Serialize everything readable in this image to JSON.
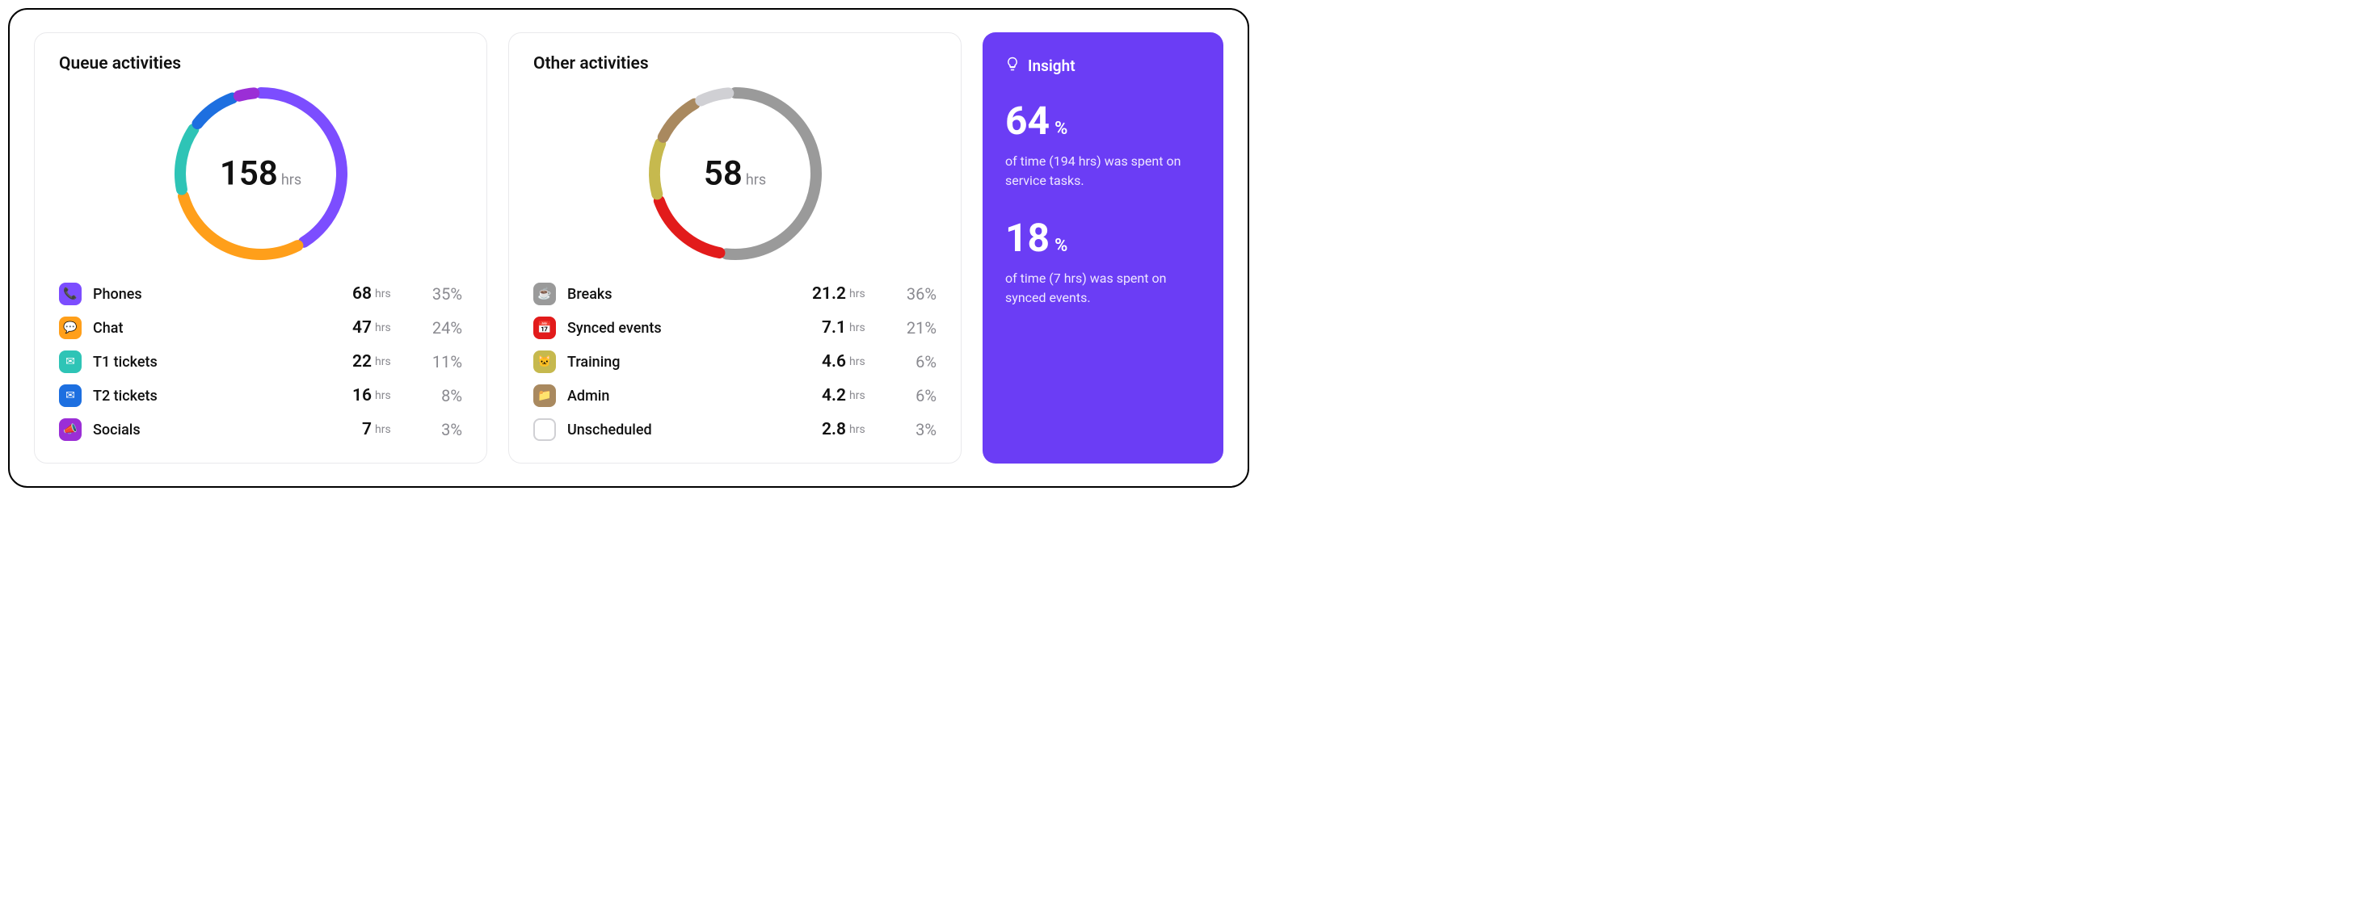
{
  "queue": {
    "title": "Queue activities",
    "total_value": "158",
    "total_unit": "hrs",
    "items": [
      {
        "label": "Phones",
        "hours": "68",
        "unit": "hrs",
        "pct": "35%",
        "icon": "phones",
        "color": "#7c4dff"
      },
      {
        "label": "Chat",
        "hours": "47",
        "unit": "hrs",
        "pct": "24%",
        "icon": "chat",
        "color": "#ff9f1a"
      },
      {
        "label": "T1 tickets",
        "hours": "22",
        "unit": "hrs",
        "pct": "11%",
        "icon": "t1",
        "color": "#2ec4b6"
      },
      {
        "label": "T2 tickets",
        "hours": "16",
        "unit": "hrs",
        "pct": "8%",
        "icon": "t2",
        "color": "#1d6fe0"
      },
      {
        "label": "Socials",
        "hours": "7",
        "unit": "hrs",
        "pct": "3%",
        "icon": "socials",
        "color": "#9b2ed6"
      }
    ]
  },
  "other": {
    "title": "Other activities",
    "total_value": "58",
    "total_unit": "hrs",
    "items": [
      {
        "label": "Breaks",
        "hours": "21.2",
        "unit": "hrs",
        "pct": "36%",
        "icon": "breaks",
        "color": "#9a9a9a"
      },
      {
        "label": "Synced events",
        "hours": "7.1",
        "unit": "hrs",
        "pct": "21%",
        "icon": "synced",
        "color": "#e21b1b"
      },
      {
        "label": "Training",
        "hours": "4.6",
        "unit": "hrs",
        "pct": "6%",
        "icon": "training",
        "color": "#c6b94e"
      },
      {
        "label": "Admin",
        "hours": "4.2",
        "unit": "hrs",
        "pct": "6%",
        "icon": "admin",
        "color": "#a9895f"
      },
      {
        "label": "Unscheduled",
        "hours": "2.8",
        "unit": "hrs",
        "pct": "3%",
        "icon": "unsched",
        "color": "#ffffff"
      }
    ]
  },
  "insight": {
    "heading": "Insight",
    "stat1_value": "64",
    "stat1_pct": "%",
    "stat1_text": "of time (194 hrs) was spent on service tasks.",
    "stat2_value": "18",
    "stat2_pct": "%",
    "stat2_text": "of time (7 hrs) was spent on synced events."
  },
  "chart_data": [
    {
      "type": "pie",
      "title": "Queue activities",
      "center_label": "158 hrs",
      "series": [
        {
          "name": "Phones",
          "value": 68,
          "pct": 35,
          "color": "#7c4dff"
        },
        {
          "name": "Chat",
          "value": 47,
          "pct": 24,
          "color": "#ff9f1a"
        },
        {
          "name": "T1 tickets",
          "value": 22,
          "pct": 11,
          "color": "#2ec4b6"
        },
        {
          "name": "T2 tickets",
          "value": 16,
          "pct": 8,
          "color": "#1d6fe0"
        },
        {
          "name": "Socials",
          "value": 7,
          "pct": 3,
          "color": "#9b2ed6"
        }
      ]
    },
    {
      "type": "pie",
      "title": "Other activities",
      "center_label": "58 hrs",
      "series": [
        {
          "name": "Breaks",
          "value": 21.2,
          "pct": 36,
          "color": "#9a9a9a"
        },
        {
          "name": "Synced events",
          "value": 7.1,
          "pct": 21,
          "color": "#e21b1b"
        },
        {
          "name": "Training",
          "value": 4.6,
          "pct": 6,
          "color": "#c6b94e"
        },
        {
          "name": "Admin",
          "value": 4.2,
          "pct": 6,
          "color": "#a9895f"
        },
        {
          "name": "Unscheduled",
          "value": 2.8,
          "pct": 3,
          "color": "#ffffff"
        }
      ]
    }
  ]
}
